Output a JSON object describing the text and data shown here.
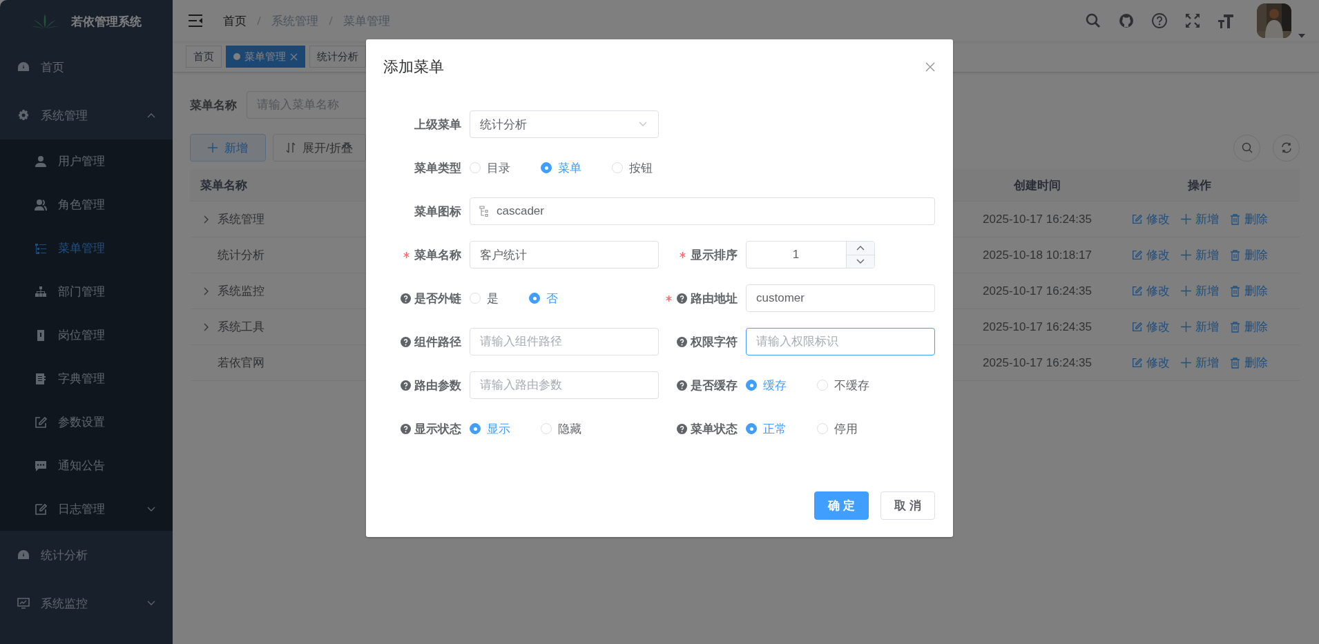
{
  "sidebar": {
    "logo_text": "若依管理系统",
    "items": [
      {
        "label": "首页",
        "selected": false
      },
      {
        "label": "系统管理",
        "selected": false,
        "expanded": true,
        "children": [
          {
            "label": "用户管理",
            "selected": false
          },
          {
            "label": "角色管理",
            "selected": false
          },
          {
            "label": "菜单管理",
            "selected": true
          },
          {
            "label": "部门管理",
            "selected": false
          },
          {
            "label": "岗位管理",
            "selected": false
          },
          {
            "label": "字典管理",
            "selected": false
          },
          {
            "label": "参数设置",
            "selected": false
          },
          {
            "label": "通知公告",
            "selected": false
          },
          {
            "label": "日志管理",
            "selected": false,
            "expanded": false
          }
        ]
      },
      {
        "label": "统计分析",
        "selected": false
      },
      {
        "label": "系统监控",
        "selected": false,
        "expanded": false
      }
    ]
  },
  "header": {
    "breadcrumb": [
      {
        "label": "首页",
        "link": true
      },
      {
        "label": "系统管理",
        "link": false
      },
      {
        "label": "菜单管理",
        "link": false
      }
    ]
  },
  "tags": [
    {
      "label": "首页",
      "selected": false,
      "closable": false
    },
    {
      "label": "菜单管理",
      "selected": true,
      "closable": true
    },
    {
      "label": "统计分析",
      "selected": false,
      "closable": false
    }
  ],
  "search": {
    "label": "菜单名称",
    "placeholder": "请输入菜单名称"
  },
  "toolbar": {
    "buttons": [
      {
        "label": "新增",
        "kind": "add"
      },
      {
        "label": "展开/折叠",
        "kind": "toggle"
      }
    ]
  },
  "table": {
    "columns": [
      "菜单名称",
      "创建时间",
      "操作"
    ],
    "rows": [
      {
        "name": "系统管理",
        "expandable": true,
        "created": "2025-10-17 16:24:35",
        "actions": [
          {
            "label": "修改",
            "kind": "edit"
          },
          {
            "label": "新增",
            "kind": "add"
          },
          {
            "label": "删除",
            "kind": "delete"
          }
        ]
      },
      {
        "name": "统计分析",
        "expandable": false,
        "created": "2025-10-18 10:18:17",
        "actions": [
          {
            "label": "修改",
            "kind": "edit"
          },
          {
            "label": "新增",
            "kind": "add"
          },
          {
            "label": "删除",
            "kind": "delete"
          }
        ]
      },
      {
        "name": "系统监控",
        "expandable": true,
        "created": "2025-10-17 16:24:35",
        "actions": [
          {
            "label": "修改",
            "kind": "edit"
          },
          {
            "label": "新增",
            "kind": "add"
          },
          {
            "label": "删除",
            "kind": "delete"
          }
        ]
      },
      {
        "name": "系统工具",
        "expandable": true,
        "created": "2025-10-17 16:24:35",
        "actions": [
          {
            "label": "修改",
            "kind": "edit"
          },
          {
            "label": "新增",
            "kind": "add"
          },
          {
            "label": "删除",
            "kind": "delete"
          }
        ]
      },
      {
        "name": "若依官网",
        "expandable": false,
        "created": "2025-10-17 16:24:35",
        "actions": [
          {
            "label": "修改",
            "kind": "edit"
          },
          {
            "label": "新增",
            "kind": "add"
          },
          {
            "label": "删除",
            "kind": "delete"
          }
        ]
      }
    ]
  },
  "dialog": {
    "title": "添加菜单",
    "rows": [
      [
        {
          "kind": "select",
          "label": "上级菜单",
          "required": false,
          "help": false,
          "value": "统计分析"
        }
      ],
      [
        {
          "kind": "radio",
          "label": "菜单类型",
          "required": false,
          "help": false,
          "options": [
            {
              "label": "目录",
              "selected": false
            },
            {
              "label": "菜单",
              "selected": true
            },
            {
              "label": "按钮",
              "selected": false
            }
          ]
        }
      ],
      [
        {
          "kind": "icon-input",
          "label": "菜单图标",
          "required": false,
          "help": false,
          "value": "cascader"
        }
      ],
      [
        {
          "kind": "input",
          "label": "菜单名称",
          "required": true,
          "help": false,
          "value": "客户统计",
          "focused": false
        },
        {
          "kind": "number",
          "label": "显示排序",
          "required": true,
          "help": false,
          "value": "1"
        }
      ],
      [
        {
          "kind": "radio",
          "label": "是否外链",
          "required": false,
          "help": true,
          "options": [
            {
              "label": "是",
              "selected": false
            },
            {
              "label": "否",
              "selected": true
            }
          ]
        },
        {
          "kind": "input",
          "label": "路由地址",
          "required": true,
          "help": true,
          "value": "customer",
          "focused": false
        }
      ],
      [
        {
          "kind": "input",
          "label": "组件路径",
          "required": false,
          "help": true,
          "placeholder": "请输入组件路径",
          "focused": false
        },
        {
          "kind": "input",
          "label": "权限字符",
          "required": false,
          "help": true,
          "placeholder": "请输入权限标识",
          "focused": true
        }
      ],
      [
        {
          "kind": "input",
          "label": "路由参数",
          "required": false,
          "help": true,
          "placeholder": "请输入路由参数",
          "focused": false
        },
        {
          "kind": "radio",
          "label": "是否缓存",
          "required": false,
          "help": true,
          "options": [
            {
              "label": "缓存",
              "selected": true
            },
            {
              "label": "不缓存",
              "selected": false
            }
          ]
        }
      ],
      [
        {
          "kind": "radio",
          "label": "显示状态",
          "required": false,
          "help": true,
          "options": [
            {
              "label": "显示",
              "selected": true
            },
            {
              "label": "隐藏",
              "selected": false
            }
          ]
        },
        {
          "kind": "radio",
          "label": "菜单状态",
          "required": false,
          "help": true,
          "options": [
            {
              "label": "正常",
              "selected": true
            },
            {
              "label": "停用",
              "selected": false
            }
          ]
        }
      ]
    ],
    "buttons": [
      {
        "label": "确 定",
        "kind": "primary"
      },
      {
        "label": "取 消",
        "kind": "default"
      }
    ]
  }
}
